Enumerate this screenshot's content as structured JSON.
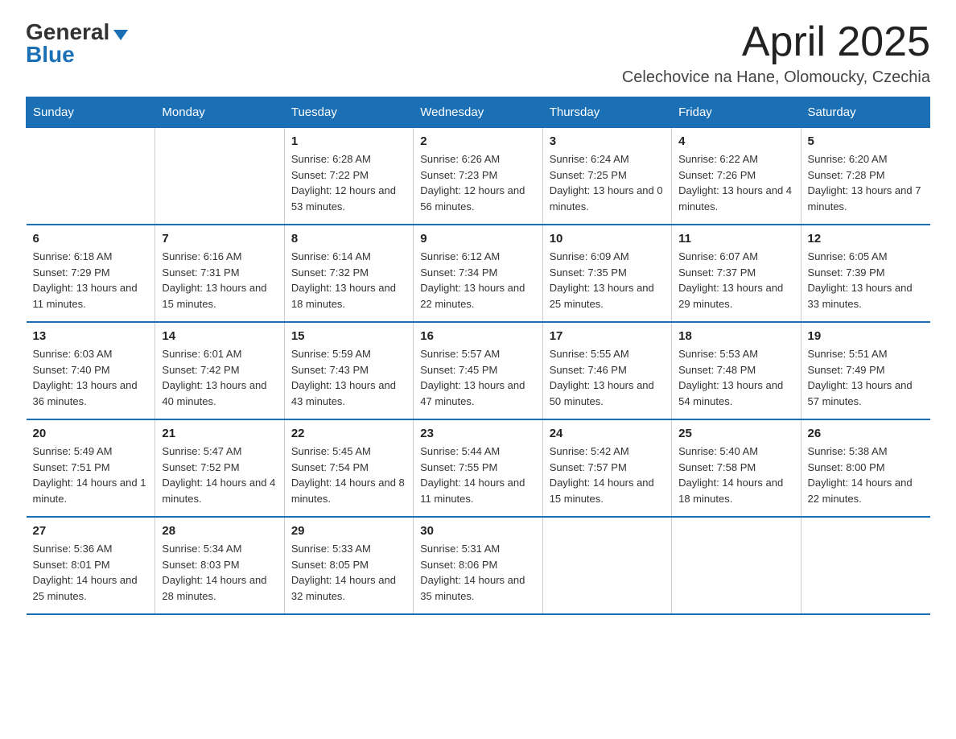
{
  "header": {
    "logo_general": "General",
    "logo_blue": "Blue",
    "month_title": "April 2025",
    "location": "Celechovice na Hane, Olomoucky, Czechia"
  },
  "days_of_week": [
    "Sunday",
    "Monday",
    "Tuesday",
    "Wednesday",
    "Thursday",
    "Friday",
    "Saturday"
  ],
  "weeks": [
    [
      {
        "day": "",
        "sunrise": "",
        "sunset": "",
        "daylight": ""
      },
      {
        "day": "",
        "sunrise": "",
        "sunset": "",
        "daylight": ""
      },
      {
        "day": "1",
        "sunrise": "Sunrise: 6:28 AM",
        "sunset": "Sunset: 7:22 PM",
        "daylight": "Daylight: 12 hours and 53 minutes."
      },
      {
        "day": "2",
        "sunrise": "Sunrise: 6:26 AM",
        "sunset": "Sunset: 7:23 PM",
        "daylight": "Daylight: 12 hours and 56 minutes."
      },
      {
        "day": "3",
        "sunrise": "Sunrise: 6:24 AM",
        "sunset": "Sunset: 7:25 PM",
        "daylight": "Daylight: 13 hours and 0 minutes."
      },
      {
        "day": "4",
        "sunrise": "Sunrise: 6:22 AM",
        "sunset": "Sunset: 7:26 PM",
        "daylight": "Daylight: 13 hours and 4 minutes."
      },
      {
        "day": "5",
        "sunrise": "Sunrise: 6:20 AM",
        "sunset": "Sunset: 7:28 PM",
        "daylight": "Daylight: 13 hours and 7 minutes."
      }
    ],
    [
      {
        "day": "6",
        "sunrise": "Sunrise: 6:18 AM",
        "sunset": "Sunset: 7:29 PM",
        "daylight": "Daylight: 13 hours and 11 minutes."
      },
      {
        "day": "7",
        "sunrise": "Sunrise: 6:16 AM",
        "sunset": "Sunset: 7:31 PM",
        "daylight": "Daylight: 13 hours and 15 minutes."
      },
      {
        "day": "8",
        "sunrise": "Sunrise: 6:14 AM",
        "sunset": "Sunset: 7:32 PM",
        "daylight": "Daylight: 13 hours and 18 minutes."
      },
      {
        "day": "9",
        "sunrise": "Sunrise: 6:12 AM",
        "sunset": "Sunset: 7:34 PM",
        "daylight": "Daylight: 13 hours and 22 minutes."
      },
      {
        "day": "10",
        "sunrise": "Sunrise: 6:09 AM",
        "sunset": "Sunset: 7:35 PM",
        "daylight": "Daylight: 13 hours and 25 minutes."
      },
      {
        "day": "11",
        "sunrise": "Sunrise: 6:07 AM",
        "sunset": "Sunset: 7:37 PM",
        "daylight": "Daylight: 13 hours and 29 minutes."
      },
      {
        "day": "12",
        "sunrise": "Sunrise: 6:05 AM",
        "sunset": "Sunset: 7:39 PM",
        "daylight": "Daylight: 13 hours and 33 minutes."
      }
    ],
    [
      {
        "day": "13",
        "sunrise": "Sunrise: 6:03 AM",
        "sunset": "Sunset: 7:40 PM",
        "daylight": "Daylight: 13 hours and 36 minutes."
      },
      {
        "day": "14",
        "sunrise": "Sunrise: 6:01 AM",
        "sunset": "Sunset: 7:42 PM",
        "daylight": "Daylight: 13 hours and 40 minutes."
      },
      {
        "day": "15",
        "sunrise": "Sunrise: 5:59 AM",
        "sunset": "Sunset: 7:43 PM",
        "daylight": "Daylight: 13 hours and 43 minutes."
      },
      {
        "day": "16",
        "sunrise": "Sunrise: 5:57 AM",
        "sunset": "Sunset: 7:45 PM",
        "daylight": "Daylight: 13 hours and 47 minutes."
      },
      {
        "day": "17",
        "sunrise": "Sunrise: 5:55 AM",
        "sunset": "Sunset: 7:46 PM",
        "daylight": "Daylight: 13 hours and 50 minutes."
      },
      {
        "day": "18",
        "sunrise": "Sunrise: 5:53 AM",
        "sunset": "Sunset: 7:48 PM",
        "daylight": "Daylight: 13 hours and 54 minutes."
      },
      {
        "day": "19",
        "sunrise": "Sunrise: 5:51 AM",
        "sunset": "Sunset: 7:49 PM",
        "daylight": "Daylight: 13 hours and 57 minutes."
      }
    ],
    [
      {
        "day": "20",
        "sunrise": "Sunrise: 5:49 AM",
        "sunset": "Sunset: 7:51 PM",
        "daylight": "Daylight: 14 hours and 1 minute."
      },
      {
        "day": "21",
        "sunrise": "Sunrise: 5:47 AM",
        "sunset": "Sunset: 7:52 PM",
        "daylight": "Daylight: 14 hours and 4 minutes."
      },
      {
        "day": "22",
        "sunrise": "Sunrise: 5:45 AM",
        "sunset": "Sunset: 7:54 PM",
        "daylight": "Daylight: 14 hours and 8 minutes."
      },
      {
        "day": "23",
        "sunrise": "Sunrise: 5:44 AM",
        "sunset": "Sunset: 7:55 PM",
        "daylight": "Daylight: 14 hours and 11 minutes."
      },
      {
        "day": "24",
        "sunrise": "Sunrise: 5:42 AM",
        "sunset": "Sunset: 7:57 PM",
        "daylight": "Daylight: 14 hours and 15 minutes."
      },
      {
        "day": "25",
        "sunrise": "Sunrise: 5:40 AM",
        "sunset": "Sunset: 7:58 PM",
        "daylight": "Daylight: 14 hours and 18 minutes."
      },
      {
        "day": "26",
        "sunrise": "Sunrise: 5:38 AM",
        "sunset": "Sunset: 8:00 PM",
        "daylight": "Daylight: 14 hours and 22 minutes."
      }
    ],
    [
      {
        "day": "27",
        "sunrise": "Sunrise: 5:36 AM",
        "sunset": "Sunset: 8:01 PM",
        "daylight": "Daylight: 14 hours and 25 minutes."
      },
      {
        "day": "28",
        "sunrise": "Sunrise: 5:34 AM",
        "sunset": "Sunset: 8:03 PM",
        "daylight": "Daylight: 14 hours and 28 minutes."
      },
      {
        "day": "29",
        "sunrise": "Sunrise: 5:33 AM",
        "sunset": "Sunset: 8:05 PM",
        "daylight": "Daylight: 14 hours and 32 minutes."
      },
      {
        "day": "30",
        "sunrise": "Sunrise: 5:31 AM",
        "sunset": "Sunset: 8:06 PM",
        "daylight": "Daylight: 14 hours and 35 minutes."
      },
      {
        "day": "",
        "sunrise": "",
        "sunset": "",
        "daylight": ""
      },
      {
        "day": "",
        "sunrise": "",
        "sunset": "",
        "daylight": ""
      },
      {
        "day": "",
        "sunrise": "",
        "sunset": "",
        "daylight": ""
      }
    ]
  ]
}
